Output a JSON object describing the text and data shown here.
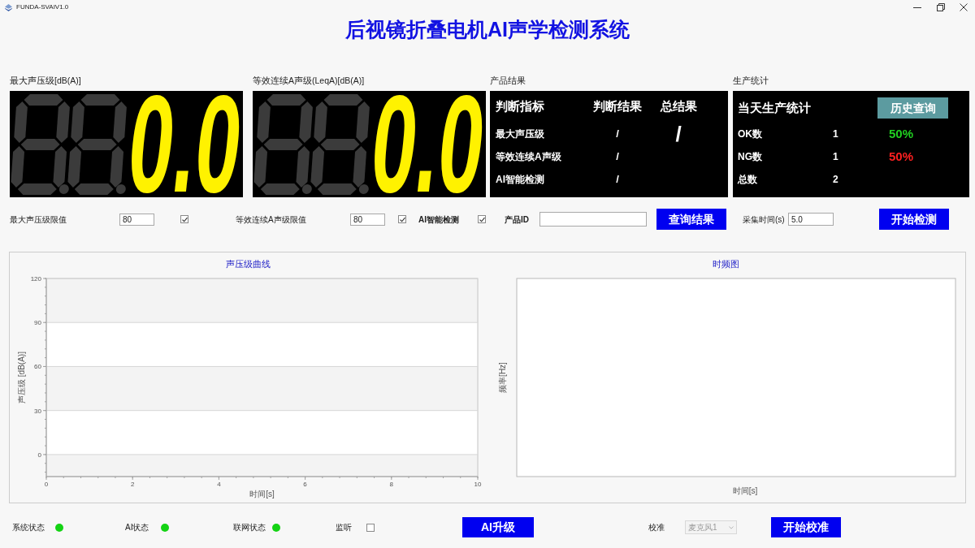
{
  "window": {
    "title": "FUNDA-SVAIV1.0"
  },
  "header": {
    "title": "后视镜折叠电机AI声学检测系统"
  },
  "meters": [
    {
      "label": "最大声压级[dB(A)]",
      "reading": "0.0"
    },
    {
      "label": "等效连续A声级(LeqA)[dB(A)]",
      "reading": "0.0"
    }
  ],
  "product_result": {
    "label": "产品结果",
    "columns": [
      "判断指标",
      "判断结果",
      "总结果"
    ],
    "rows": [
      {
        "name": "最大声压级",
        "result": "/"
      },
      {
        "name": "等效连续A声级",
        "result": "/"
      },
      {
        "name": "AI智能检测",
        "result": "/"
      }
    ],
    "overall": "/"
  },
  "production_stats": {
    "label": "生产统计",
    "title": "当天生产统计",
    "history_button": "历史查询",
    "rows": [
      {
        "name": "OK数",
        "count": "1",
        "share": "50%",
        "color": "#20d020"
      },
      {
        "name": "NG数",
        "count": "1",
        "share": "50%",
        "color": "#ff2020"
      },
      {
        "name": "总数",
        "count": "2"
      }
    ]
  },
  "controls": {
    "max_level_limit": {
      "label": "最大声压级限值",
      "value": "80",
      "checked": true
    },
    "leq_limit": {
      "label": "等效连续A声级限值",
      "value": "80",
      "checked": true
    },
    "ai_detection": {
      "label": "AI智能检测",
      "checked": true
    },
    "product_id": {
      "label": "产品ID"
    },
    "query_button": "查询结果",
    "sampling_time": {
      "label": "采集时间(s)",
      "value": "5.0"
    },
    "start_button": "开始检测"
  },
  "charts": {
    "spl_curve": {
      "chart_data": {
        "type": "line",
        "title": "声压级曲线",
        "xlabel": "时间[s]",
        "ylabel": "声压级 [dB(A)]",
        "xlim": [
          0,
          10
        ],
        "ylim": [
          -15,
          120
        ],
        "xticks": [
          0,
          2,
          4,
          6,
          8,
          10
        ],
        "yticks": [
          0,
          30,
          60,
          90,
          120
        ],
        "grid": true
      }
    },
    "spectrogram": {
      "title": "时频图",
      "xlabel": "时间[s]",
      "ylabel": "频率[Hz]"
    }
  },
  "status_bar": {
    "indicators": [
      {
        "label": "系统状态",
        "color": "#14d314"
      },
      {
        "label": "AI状态",
        "color": "#14d314"
      },
      {
        "label": "联网状态",
        "color": "#14d314"
      }
    ],
    "monitor": {
      "label": "监听",
      "checked": false
    },
    "upgrade_button": "AI升级",
    "calibration": {
      "label": "校准",
      "microphone": {
        "value": "麦克风1",
        "disabled": true
      },
      "button": "开始校准"
    }
  }
}
